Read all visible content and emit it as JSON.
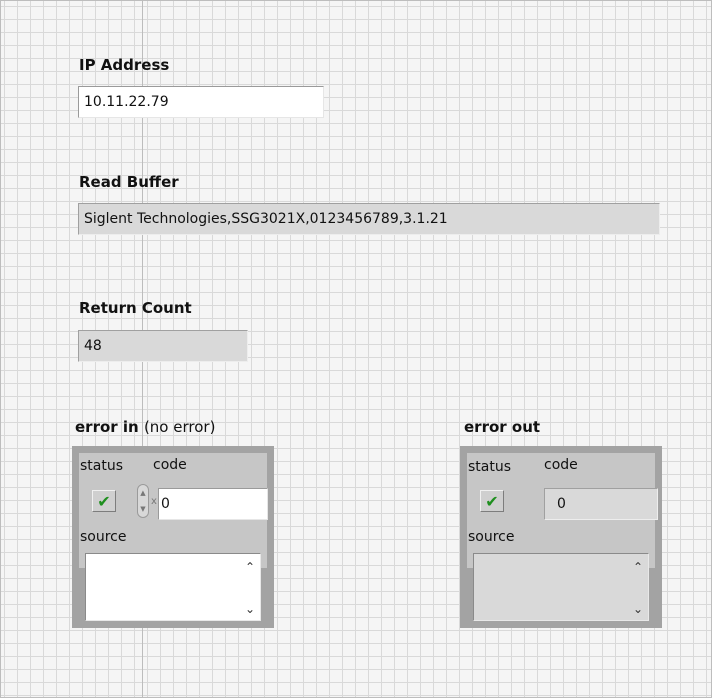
{
  "ip_address": {
    "label": "IP Address",
    "value": "10.11.22.79"
  },
  "read_buffer": {
    "label": "Read Buffer",
    "value": "Siglent Technologies,SSG3021X,0123456789,3.1.21"
  },
  "return_count": {
    "label": "Return Count",
    "value": "48"
  },
  "error_in": {
    "label": "error in",
    "label_note": "(no error)",
    "status_label": "status",
    "code_label": "code",
    "code_value": "0",
    "radix": "x",
    "source_label": "source",
    "source_value": "",
    "status_glyph": "✔",
    "spinner_up": "▲",
    "spinner_down": "▼",
    "scroll_up": "⌃",
    "scroll_down": "⌄"
  },
  "error_out": {
    "label": "error out",
    "status_label": "status",
    "code_label": "code",
    "code_value": "0",
    "radix": "x",
    "source_label": "source",
    "source_value": "",
    "status_glyph": "✔",
    "scroll_up": "⌃",
    "scroll_down": "⌄"
  },
  "colors": {
    "grid_line": "#d9d9d9",
    "indicator_bg": "#d9d9d9",
    "cluster_frame": "#a3a3a3",
    "status_ok": "#1f8f1f"
  },
  "icons": {
    "status": "checkmark-icon",
    "increment": "spinner-up-icon",
    "decrement": "spinner-down-icon",
    "scroll_up": "chevron-up-icon",
    "scroll_down": "chevron-down-icon"
  }
}
